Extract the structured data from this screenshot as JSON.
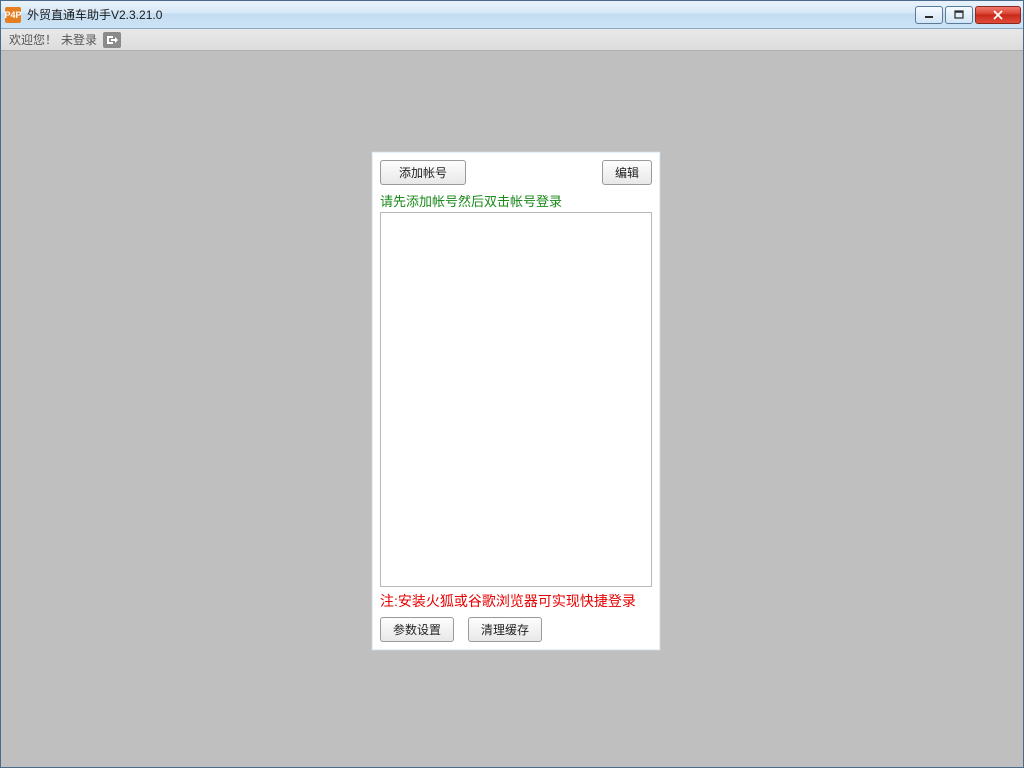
{
  "window": {
    "title": "外贸直通车助手V2.3.21.0",
    "icon_text": "P4P"
  },
  "statusbar": {
    "welcome": "欢迎您！",
    "login_state": "未登录"
  },
  "panel": {
    "add_account_label": "添加帐号",
    "edit_label": "编辑",
    "hint_green": "请先添加帐号然后双击帐号登录",
    "hint_red": "注:安装火狐或谷歌浏览器可实现快捷登录",
    "param_settings_label": "参数设置",
    "clear_cache_label": "清理缓存",
    "accounts": []
  }
}
